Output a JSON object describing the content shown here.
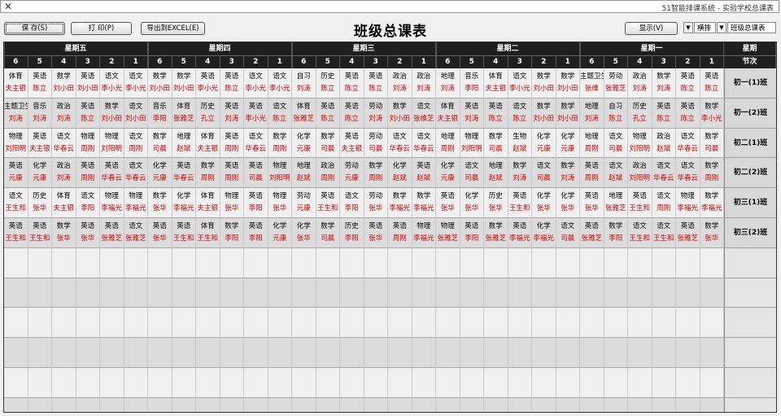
{
  "window": {
    "title": "51智能排课系统 - 实验学校总课表",
    "close_icon": "close-icon"
  },
  "page_title": "班级总课表",
  "toolbar": {
    "view_select": "班级总课表",
    "layout_select": "横排",
    "empty_select": "",
    "show_label": "显示(V)",
    "export_label": "导出到EXCEL(E)",
    "print_label": "打 印(P)",
    "save_label": "保 存(S)"
  },
  "colors": {
    "header_bg": "#1f1f1f",
    "teacher_text": "#d40000",
    "row_odd": "#f0f0f0",
    "row_even": "#dcdcdc"
  },
  "grid": {
    "corner_top": "星期",
    "corner_bottom": "节次",
    "days": [
      "星期一",
      "星期二",
      "星期三",
      "星期四",
      "星期五"
    ],
    "periods": [
      "1",
      "2",
      "3",
      "4",
      "5",
      "6"
    ],
    "classes": [
      {
        "name": "初一(1)班",
        "cells": [
          [
            {
              "s": "英语",
              "t": "陈立"
            },
            {
              "s": "英语",
              "t": "陈立"
            },
            {
              "s": "数学",
              "t": "刘涛"
            },
            {
              "s": "政治",
              "t": "刘涛"
            },
            {
              "s": "劳动",
              "t": "张雅芝"
            },
            {
              "s": "主题卫生",
              "t": "张维"
            }
          ],
          [
            {
              "s": "数学",
              "t": "刘小田"
            },
            {
              "s": "数学",
              "t": "刘小田"
            },
            {
              "s": "语文",
              "t": "李小光"
            },
            {
              "s": "体育",
              "t": "夫主银"
            },
            {
              "s": "音乐",
              "t": "李阳"
            },
            {
              "s": "地理",
              "t": "刘涛"
            }
          ],
          [
            {
              "s": "政治",
              "t": "刘涛"
            },
            {
              "s": "政治",
              "t": "刘涛"
            },
            {
              "s": "英语",
              "t": "陈立"
            },
            {
              "s": "英语",
              "t": "陈立"
            },
            {
              "s": "历史",
              "t": "陈立"
            },
            {
              "s": "自习",
              "t": "刘涛"
            }
          ],
          [
            {
              "s": "语文",
              "t": "李小光"
            },
            {
              "s": "语文",
              "t": "李小光"
            },
            {
              "s": "英语",
              "t": "陈立"
            },
            {
              "s": "英语",
              "t": "李小光"
            },
            {
              "s": "数学",
              "t": "刘小田"
            },
            {
              "s": "数学",
              "t": "刘小田"
            }
          ],
          [
            {
              "s": "语文",
              "t": "李小光"
            },
            {
              "s": "语文",
              "t": "李小光"
            },
            {
              "s": "英语",
              "t": "刘小田"
            },
            {
              "s": "数学",
              "t": "刘小田"
            },
            {
              "s": "英语",
              "t": "陈立"
            },
            {
              "s": "体育",
              "t": "夫主银"
            }
          ]
        ]
      },
      {
        "name": "初一(2)班",
        "cells": [
          [
            {
              "s": "数学",
              "t": "李小光"
            },
            {
              "s": "英语",
              "t": "陈立"
            },
            {
              "s": "英语",
              "t": "陈立"
            },
            {
              "s": "历史",
              "t": "孔立"
            },
            {
              "s": "自习",
              "t": "陈立"
            },
            {
              "s": "地理",
              "t": "刘涛"
            }
          ],
          [
            {
              "s": "数学",
              "t": "刘小田"
            },
            {
              "s": "数学",
              "t": "刘小田"
            },
            {
              "s": "语文",
              "t": "陈立"
            },
            {
              "s": "英语",
              "t": "陈立"
            },
            {
              "s": "英语",
              "t": "刘涛"
            },
            {
              "s": "体育",
              "t": "夫主银"
            }
          ],
          [
            {
              "s": "语文",
              "t": "张维芝"
            },
            {
              "s": "数学",
              "t": "刘小田"
            },
            {
              "s": "劳动",
              "t": "刘涛"
            },
            {
              "s": "英语",
              "t": "陈立"
            },
            {
              "s": "英语",
              "t": "陈立"
            },
            {
              "s": "体育",
              "t": "张雅芝"
            }
          ],
          [
            {
              "s": "语文",
              "t": "陈立"
            },
            {
              "s": "英语",
              "t": "李小光"
            },
            {
              "s": "英语",
              "t": "刘涛"
            },
            {
              "s": "历史",
              "t": "孔立"
            },
            {
              "s": "体育",
              "t": "张雅芝"
            },
            {
              "s": "音乐",
              "t": "李阳"
            }
          ],
          [
            {
              "s": "语文",
              "t": "刘小田"
            },
            {
              "s": "数学",
              "t": "刘小田"
            },
            {
              "s": "英语",
              "t": "陈立"
            },
            {
              "s": "政治",
              "t": "刘涛"
            },
            {
              "s": "音乐",
              "t": "刘涛"
            },
            {
              "s": "主题卫生",
              "t": "刘涛"
            }
          ]
        ]
      },
      {
        "name": "初二(1)班",
        "cells": [
          [
            {
              "s": "数学",
              "t": "司晨"
            },
            {
              "s": "语文",
              "t": "华春云"
            },
            {
              "s": "政治",
              "t": "赵斌"
            },
            {
              "s": "物理",
              "t": "刘阳明"
            },
            {
              "s": "语文",
              "t": "司晨"
            },
            {
              "s": "地理",
              "t": "周刚"
            }
          ],
          [
            {
              "s": "化学",
              "t": "元康"
            },
            {
              "s": "化学",
              "t": "元康"
            },
            {
              "s": "生物",
              "t": "赵斌"
            },
            {
              "s": "数学",
              "t": "司晨"
            },
            {
              "s": "物理",
              "t": "刘阳明"
            },
            {
              "s": "地理",
              "t": "周刚"
            }
          ],
          [
            {
              "s": "语文",
              "t": "华春云"
            },
            {
              "s": "语文",
              "t": "华春云"
            },
            {
              "s": "劳动",
              "t": "司晨"
            },
            {
              "s": "英语",
              "t": "夫主银"
            },
            {
              "s": "数学",
              "t": "司晨"
            },
            {
              "s": "化学",
              "t": "元康"
            }
          ],
          [
            {
              "s": "数学",
              "t": "周刚"
            },
            {
              "s": "语文",
              "t": "华春云"
            },
            {
              "s": "英语",
              "t": "周刚"
            },
            {
              "s": "体育",
              "t": "夫主银"
            },
            {
              "s": "地理",
              "t": "赵斌"
            },
            {
              "s": "数学",
              "t": "司晨"
            }
          ],
          [
            {
              "s": "语文",
              "t": "周刚"
            },
            {
              "s": "物理",
              "t": "刘阳明"
            },
            {
              "s": "物理",
              "t": "周刚"
            },
            {
              "s": "语文",
              "t": "华春云"
            },
            {
              "s": "英语",
              "t": "夫主银"
            },
            {
              "s": "物理",
              "t": "刘阳明"
            }
          ]
        ]
      },
      {
        "name": "初二(2)班",
        "cells": [
          [
            {
              "s": "数学",
              "t": "周刚"
            },
            {
              "s": "语文",
              "t": "华春云"
            },
            {
              "s": "语文",
              "t": "华春云"
            },
            {
              "s": "政治",
              "t": "刘阳明"
            },
            {
              "s": "语文",
              "t": "赵斌"
            },
            {
              "s": "英语",
              "t": "周刚"
            }
          ],
          [
            {
              "s": "数学",
              "t": "刘涛"
            },
            {
              "s": "语文",
              "t": "司晨"
            },
            {
              "s": "数学",
              "t": "刘涛"
            },
            {
              "s": "地理",
              "t": "赵斌"
            },
            {
              "s": "语文",
              "t": "司晨"
            },
            {
              "s": "化学",
              "t": "元康"
            }
          ],
          [
            {
              "s": "英语",
              "t": "赵斌"
            },
            {
              "s": "化学",
              "t": "赵斌"
            },
            {
              "s": "数学",
              "t": "周刚"
            },
            {
              "s": "劳动",
              "t": "元康"
            },
            {
              "s": "政治",
              "t": "周刚"
            },
            {
              "s": "地理",
              "t": "赵斌"
            }
          ],
          [
            {
              "s": "物理",
              "t": "刘阳明"
            },
            {
              "s": "英语",
              "t": "司晨"
            },
            {
              "s": "英语",
              "t": "周刚"
            },
            {
              "s": "数学",
              "t": "周刚"
            },
            {
              "s": "英语",
              "t": "华春云"
            },
            {
              "s": "化学",
              "t": "元康"
            }
          ],
          [
            {
              "s": "语文",
              "t": "华春云"
            },
            {
              "s": "英语",
              "t": "华春云"
            },
            {
              "s": "英语",
              "t": "周刚"
            },
            {
              "s": "政治",
              "t": "刘涛"
            },
            {
              "s": "化学",
              "t": "元康"
            },
            {
              "s": "英语",
              "t": "元康"
            }
          ]
        ]
      },
      {
        "name": "初三(1)班",
        "cells": [
          [
            {
              "s": "数学",
              "t": "李福光"
            },
            {
              "s": "物理",
              "t": "李福光"
            },
            {
              "s": "语文",
              "t": "周刚"
            },
            {
              "s": "英语",
              "t": "王生和"
            },
            {
              "s": "地理",
              "t": "张雅芝"
            },
            {
              "s": "英语",
              "t": "张华"
            }
          ],
          [
            {
              "s": "化学",
              "t": "张华"
            },
            {
              "s": "化学",
              "t": "张华"
            },
            {
              "s": "英语",
              "t": "王生和"
            },
            {
              "s": "历史",
              "t": "张华"
            },
            {
              "s": "化学",
              "t": "张华"
            },
            {
              "s": "英语",
              "t": "张华"
            }
          ],
          [
            {
              "s": "数学",
              "t": "李福光"
            },
            {
              "s": "数学",
              "t": "李福光"
            },
            {
              "s": "劳动",
              "t": "张华"
            },
            {
              "s": "语文",
              "t": "李阳"
            },
            {
              "s": "英语",
              "t": "王生和"
            },
            {
              "s": "劳动",
              "t": "元康"
            }
          ],
          [
            {
              "s": "物理",
              "t": "张华"
            },
            {
              "s": "英语",
              "t": "李阳"
            },
            {
              "s": "物理",
              "t": "张华"
            },
            {
              "s": "体育",
              "t": "夫主银"
            },
            {
              "s": "化学",
              "t": "李福光"
            },
            {
              "s": "数学",
              "t": "张华"
            }
          ],
          [
            {
              "s": "物理",
              "t": "李福光"
            },
            {
              "s": "物理",
              "t": "李福光"
            },
            {
              "s": "语文",
              "t": "李阳"
            },
            {
              "s": "体育",
              "t": "夫主银"
            },
            {
              "s": "历史",
              "t": "张华"
            },
            {
              "s": "语文",
              "t": "王生和"
            }
          ]
        ]
      },
      {
        "name": "初三(2)班",
        "cells": [
          [
            {
              "s": "数学",
              "t": "张华"
            },
            {
              "s": "英语",
              "t": "张雅芝"
            },
            {
              "s": "语文",
              "t": "王生和"
            },
            {
              "s": "语文",
              "t": "王生和"
            },
            {
              "s": "数学",
              "t": "李阳"
            },
            {
              "s": "英语",
              "t": "张雅芝"
            }
          ],
          [
            {
              "s": "语文",
              "t": "司晨"
            },
            {
              "s": "化学",
              "t": "李福光"
            },
            {
              "s": "英语",
              "t": "李福光"
            },
            {
              "s": "数学",
              "t": "张雅芝"
            },
            {
              "s": "英语",
              "t": "李阳"
            },
            {
              "s": "物理",
              "t": "张雅芝"
            }
          ],
          [
            {
              "s": "物理",
              "t": "李福光"
            },
            {
              "s": "英语",
              "t": "周刚"
            },
            {
              "s": "英语",
              "t": "张华"
            },
            {
              "s": "历史",
              "t": "李阳"
            },
            {
              "s": "数学",
              "t": "司晨"
            },
            {
              "s": "化学",
              "t": "张华"
            }
          ],
          [
            {
              "s": "化学",
              "t": "元康"
            },
            {
              "s": "英语",
              "t": "李阳"
            },
            {
              "s": "数学",
              "t": "李阳"
            },
            {
              "s": "体育",
              "t": "王生和"
            },
            {
              "s": "英语",
              "t": "王生和"
            },
            {
              "s": "英语",
              "t": "张华"
            }
          ],
          [
            {
              "s": "语文",
              "t": "张雅芝"
            },
            {
              "s": "英语",
              "t": "张雅芝"
            },
            {
              "s": "英语",
              "t": "张华"
            },
            {
              "s": "数学",
              "t": "张华"
            },
            {
              "s": "英语",
              "t": "王生和"
            },
            {
              "s": "英语",
              "t": "王生和"
            }
          ]
        ]
      }
    ]
  }
}
